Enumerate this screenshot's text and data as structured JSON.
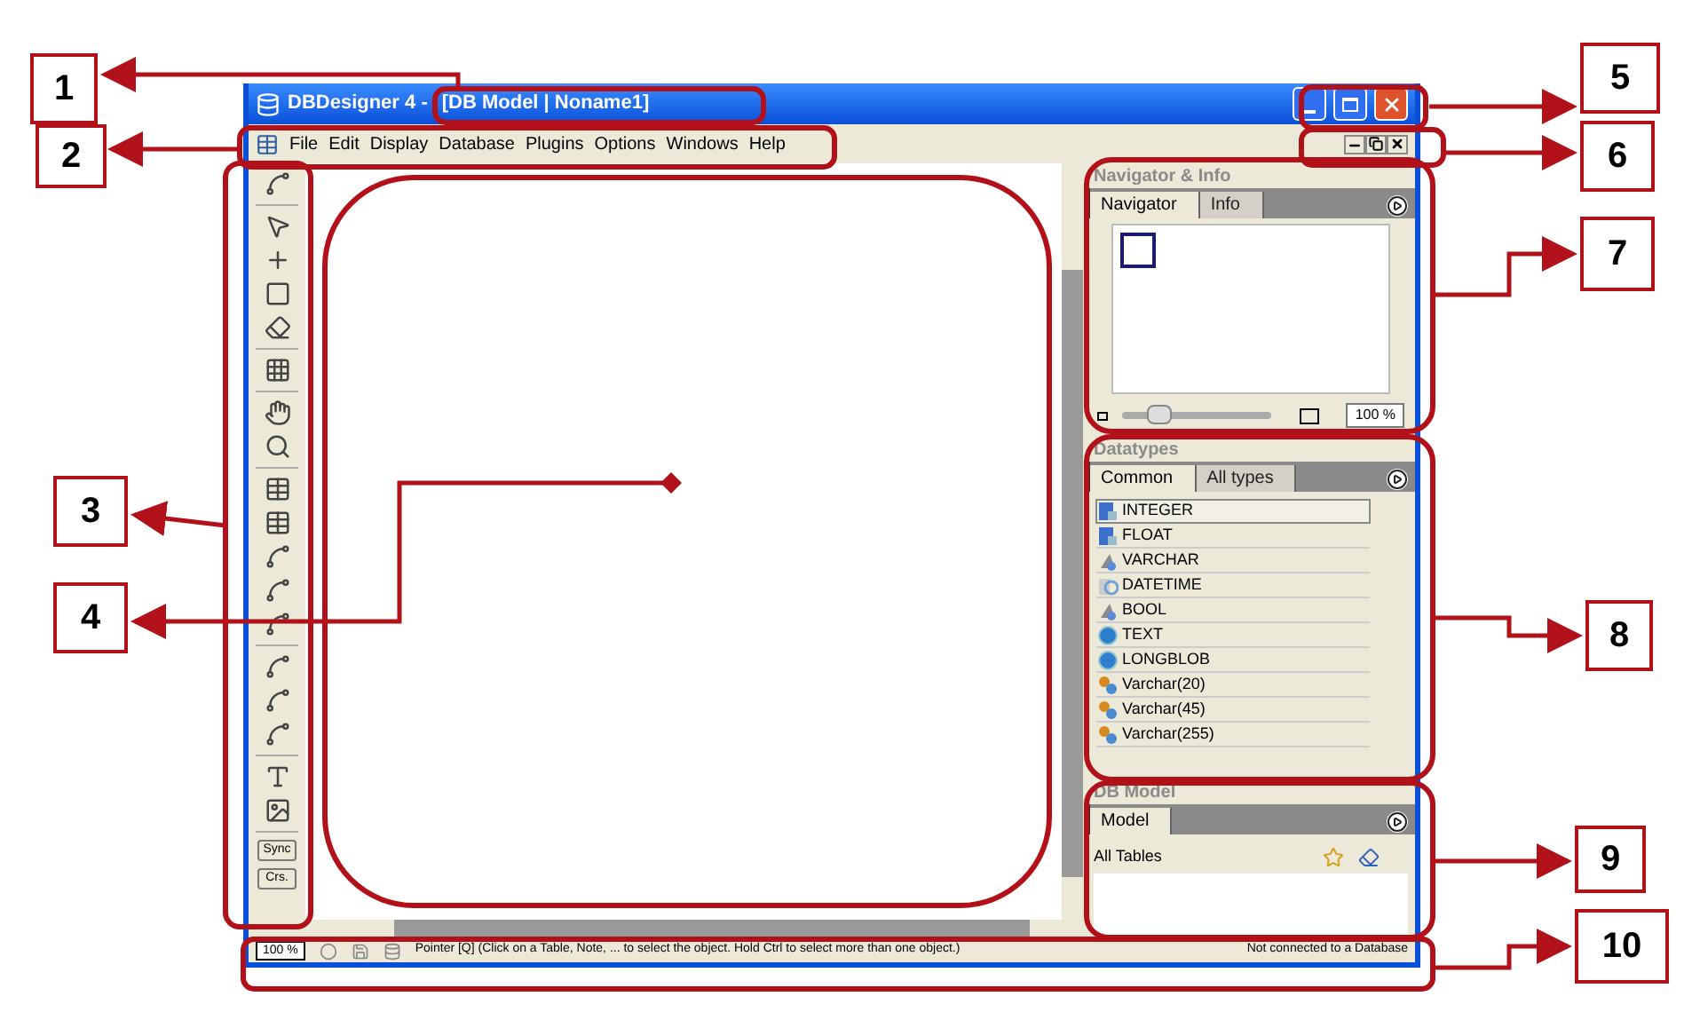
{
  "window": {
    "title": "DBDesigner 4 -",
    "document": "[DB Model | Noname1]"
  },
  "menu": [
    "File",
    "Edit",
    "Display",
    "Database",
    "Plugins",
    "Options",
    "Windows",
    "Help"
  ],
  "toolbar": {
    "buttons": [
      "Sync",
      "Crs."
    ]
  },
  "navigator": {
    "title": "Navigator & Info",
    "tabs": [
      {
        "label": "Navigator",
        "selected": true
      },
      {
        "label": "Info",
        "selected": false
      }
    ],
    "zoom": {
      "level": 0.25,
      "reading": "100 %"
    }
  },
  "datatypes": {
    "title": "Datatypes",
    "tabs": [
      {
        "label": "Common",
        "selected": true
      },
      {
        "label": "All types",
        "selected": false
      }
    ],
    "items": [
      {
        "label": "INTEGER",
        "kind": "numeric",
        "selected": true
      },
      {
        "label": "FLOAT",
        "kind": "numeric",
        "selected": false
      },
      {
        "label": "VARCHAR",
        "kind": "string",
        "selected": false
      },
      {
        "label": "DATETIME",
        "kind": "datetime",
        "selected": false
      },
      {
        "label": "BOOL",
        "kind": "string",
        "selected": false
      },
      {
        "label": "TEXT",
        "kind": "blob",
        "selected": false
      },
      {
        "label": "LONGBLOB",
        "kind": "blob",
        "selected": false
      },
      {
        "label": "Varchar(20)",
        "kind": "user",
        "selected": false
      },
      {
        "label": "Varchar(45)",
        "kind": "user",
        "selected": false
      },
      {
        "label": "Varchar(255)",
        "kind": "user",
        "selected": false
      }
    ]
  },
  "db_model": {
    "title": "DB Model",
    "tabs": [
      {
        "label": "Model",
        "selected": true
      }
    ],
    "heading": "All Tables"
  },
  "status_bar": {
    "zoom": "100 %",
    "message": "Pointer [Q] (Click on a Table, Note, ... to select the object. Hold Ctrl to select more than one object.)",
    "connection": "Not connected to a Database"
  },
  "callouts": [
    "1",
    "2",
    "3",
    "4",
    "5",
    "6",
    "7",
    "8",
    "9",
    "10"
  ]
}
